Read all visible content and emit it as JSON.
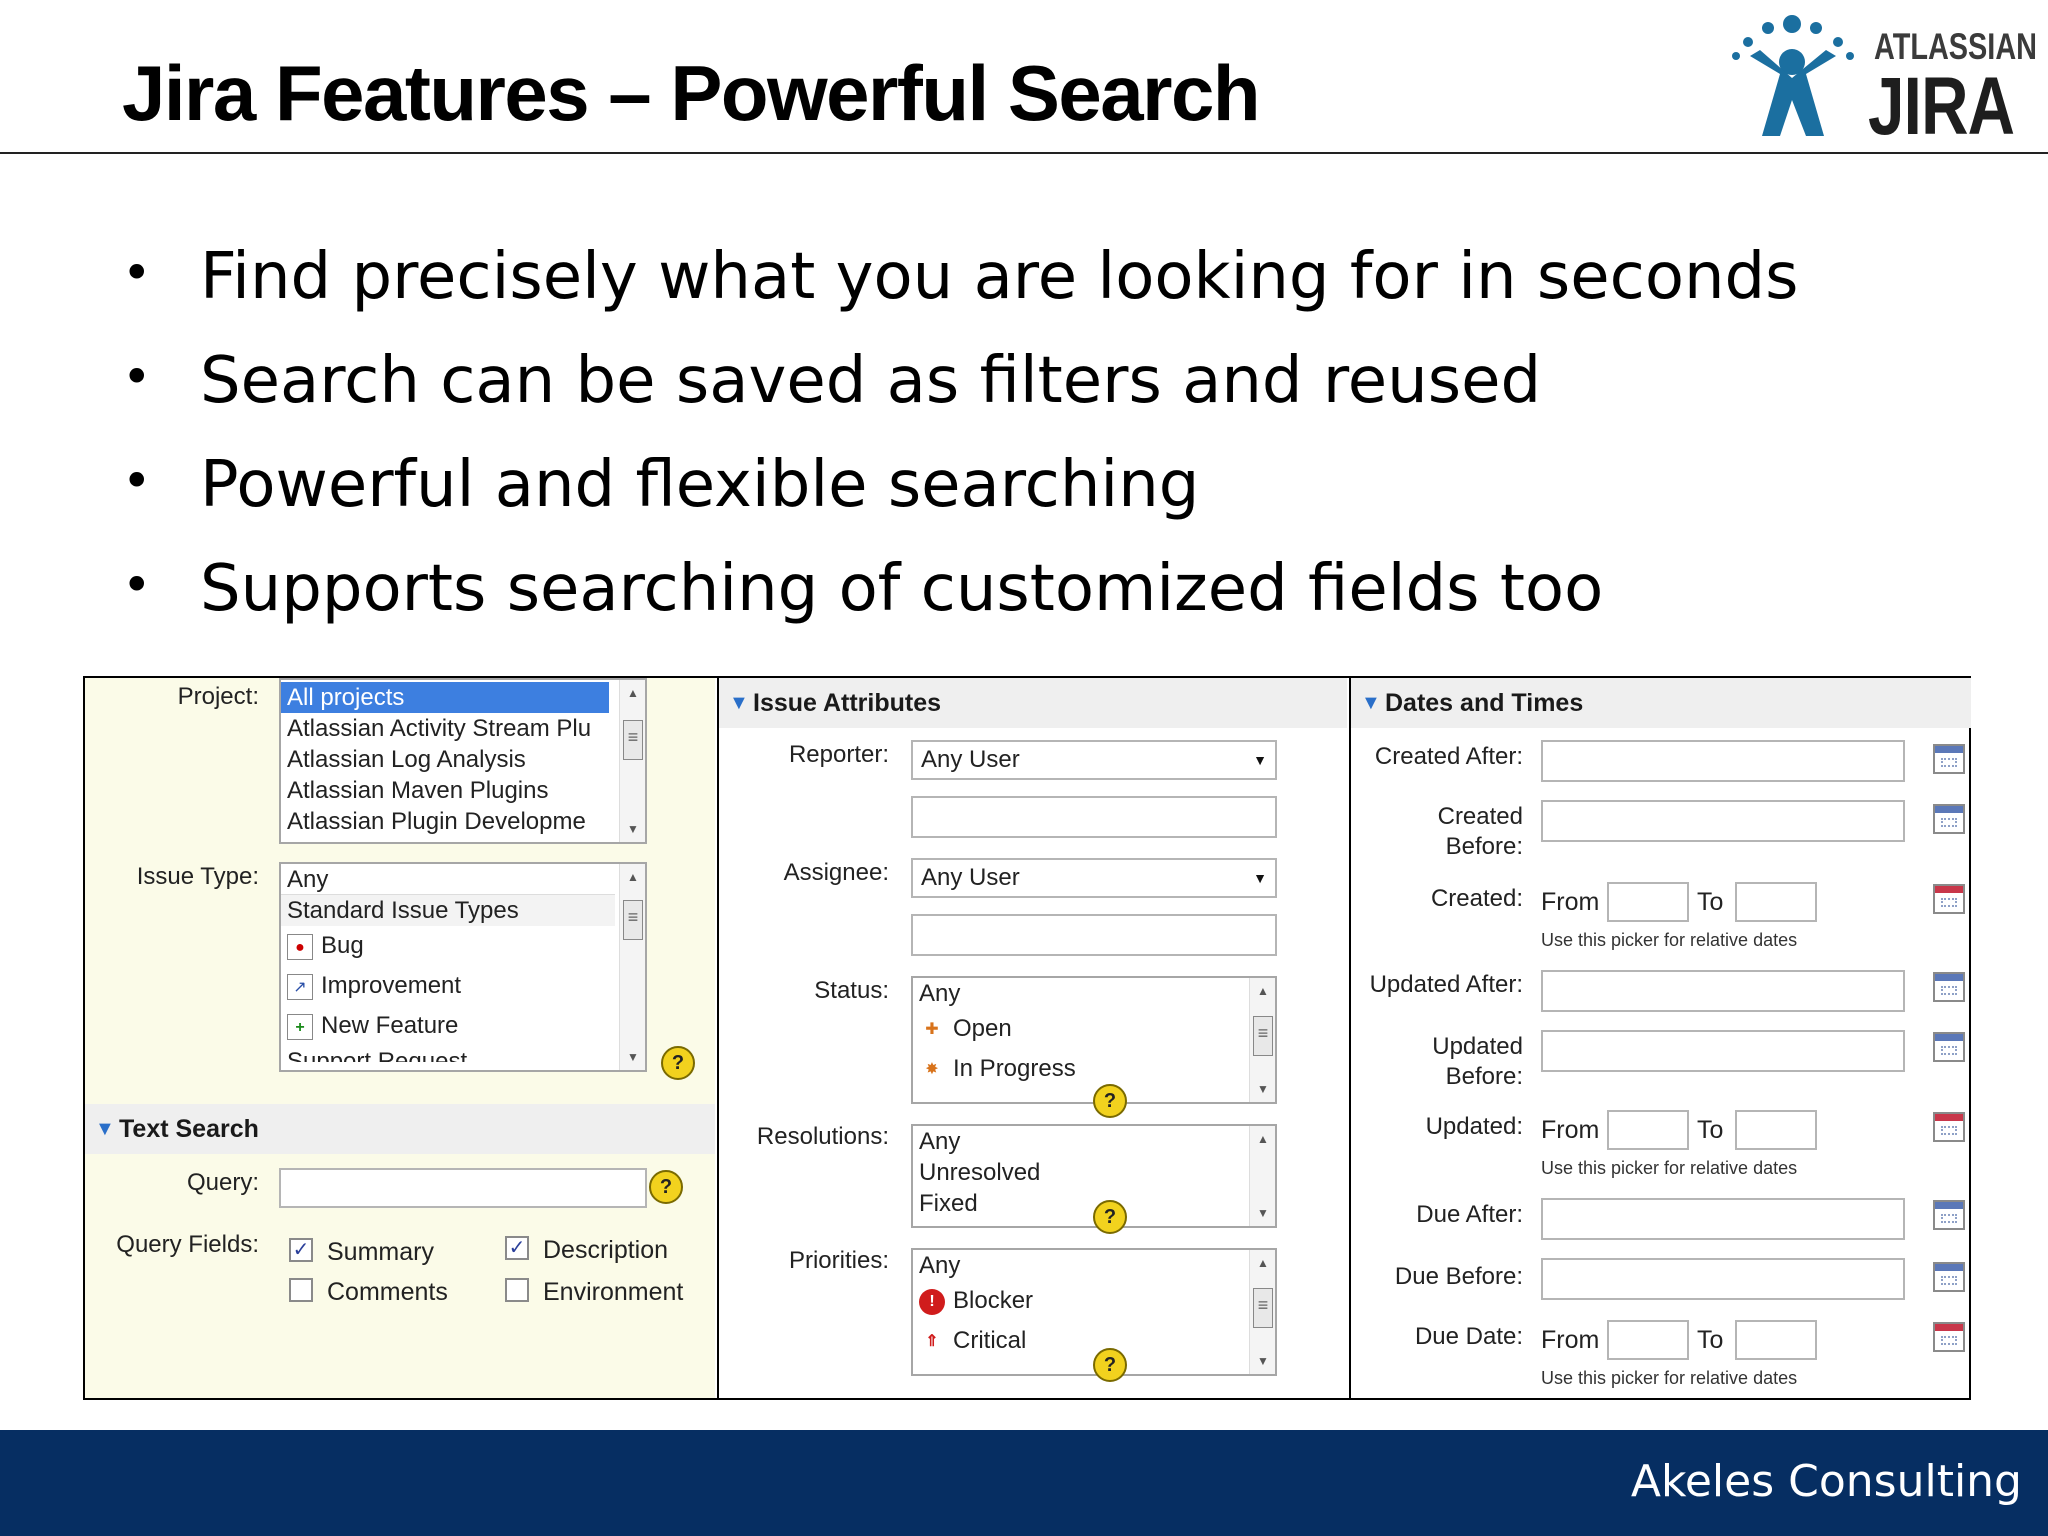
{
  "slide": {
    "title": "Jira Features – Powerful Search",
    "bullets": [
      "Find precisely what you are looking for in seconds",
      "Search can be saved as filters and reused",
      "Powerful and flexible searching",
      "Supports searching of customized fields too"
    ],
    "logo": {
      "small": "ATLASSIAN",
      "big": "JIRA"
    },
    "footer": "Akeles Consulting"
  },
  "panel1": {
    "project_label": "Project:",
    "projects": [
      "All projects",
      "Atlassian Activity Stream Plu",
      "Atlassian Log Analysis",
      "Atlassian Maven Plugins",
      "Atlassian Plugin Developme"
    ],
    "issue_type_label": "Issue Type:",
    "issue_types": [
      "Any",
      "Standard Issue Types",
      "Bug",
      "Improvement",
      "New Feature",
      "Support Request"
    ],
    "text_search_header": "Text Search",
    "query_label": "Query:",
    "query_value": "",
    "query_fields_label": "Query Fields:",
    "fields": [
      {
        "label": "Summary",
        "checked": true
      },
      {
        "label": "Description",
        "checked": true
      },
      {
        "label": "Comments",
        "checked": false
      },
      {
        "label": "Environment",
        "checked": false
      }
    ]
  },
  "panel2": {
    "header": "Issue Attributes",
    "reporter_label": "Reporter:",
    "reporter_value": "Any User",
    "reporter_text": "",
    "assignee_label": "Assignee:",
    "assignee_value": "Any User",
    "assignee_text": "",
    "status_label": "Status:",
    "statuses": [
      "Any",
      "Open",
      "In Progress"
    ],
    "resolutions_label": "Resolutions:",
    "resolutions": [
      "Any",
      "Unresolved",
      "Fixed"
    ],
    "priorities_label": "Priorities:",
    "priorities": [
      "Any",
      "Blocker",
      "Critical"
    ]
  },
  "panel3": {
    "header": "Dates and Times",
    "created_after": "Created After:",
    "created_before": [
      "Created",
      "Before:"
    ],
    "created": "Created:",
    "updated_after": "Updated After:",
    "updated_before": [
      "Updated",
      "Before:"
    ],
    "updated": "Updated:",
    "due_after": "Due After:",
    "due_before": "Due Before:",
    "due_date": "Due Date:",
    "from": "From",
    "to": "To",
    "relative_note": "Use this picker for relative dates"
  },
  "colors": {
    "footer": "#062e62",
    "selected_row": "#3d7fe0",
    "panel_cream": "#fbfbe8",
    "logo_blue": "#1b6fa0"
  },
  "icons": [
    "bug-icon",
    "improvement-icon",
    "new-feature-icon",
    "open-status-icon",
    "in-progress-icon",
    "blocker-icon",
    "critical-icon",
    "help-icon",
    "calendar-icon"
  ]
}
